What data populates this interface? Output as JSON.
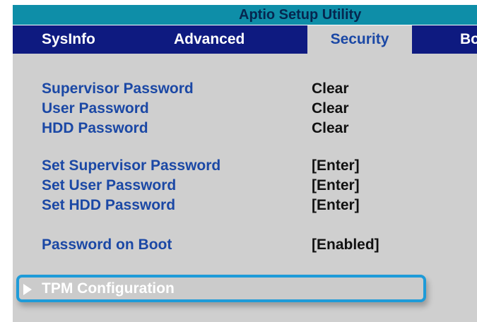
{
  "app": {
    "title": "Aptio Setup Utility"
  },
  "menu": {
    "tabs": [
      {
        "label": "SysInfo"
      },
      {
        "label": "Advanced"
      },
      {
        "label": "Security"
      },
      {
        "label": "Bo"
      }
    ],
    "active_tab": "Security"
  },
  "security": {
    "status": [
      {
        "label": "Supervisor Password",
        "value": "Clear"
      },
      {
        "label": "User Password",
        "value": "Clear"
      },
      {
        "label": "HDD Password",
        "value": "Clear"
      }
    ],
    "actions": [
      {
        "label": "Set Supervisor Password",
        "value": "[Enter]"
      },
      {
        "label": "Set User Password",
        "value": "[Enter]"
      },
      {
        "label": "Set HDD Password",
        "value": "[Enter]"
      }
    ],
    "boot": {
      "label": "Password on Boot",
      "value": "[Enabled]"
    },
    "submenu": {
      "label": "TPM Configuration"
    }
  },
  "colors": {
    "title_bar": "#0e8ea8",
    "menu_bar": "#0e1a80",
    "content_bg": "#cfcfcf",
    "label_text": "#1b48a5",
    "highlight_border": "#1e9bd8"
  }
}
